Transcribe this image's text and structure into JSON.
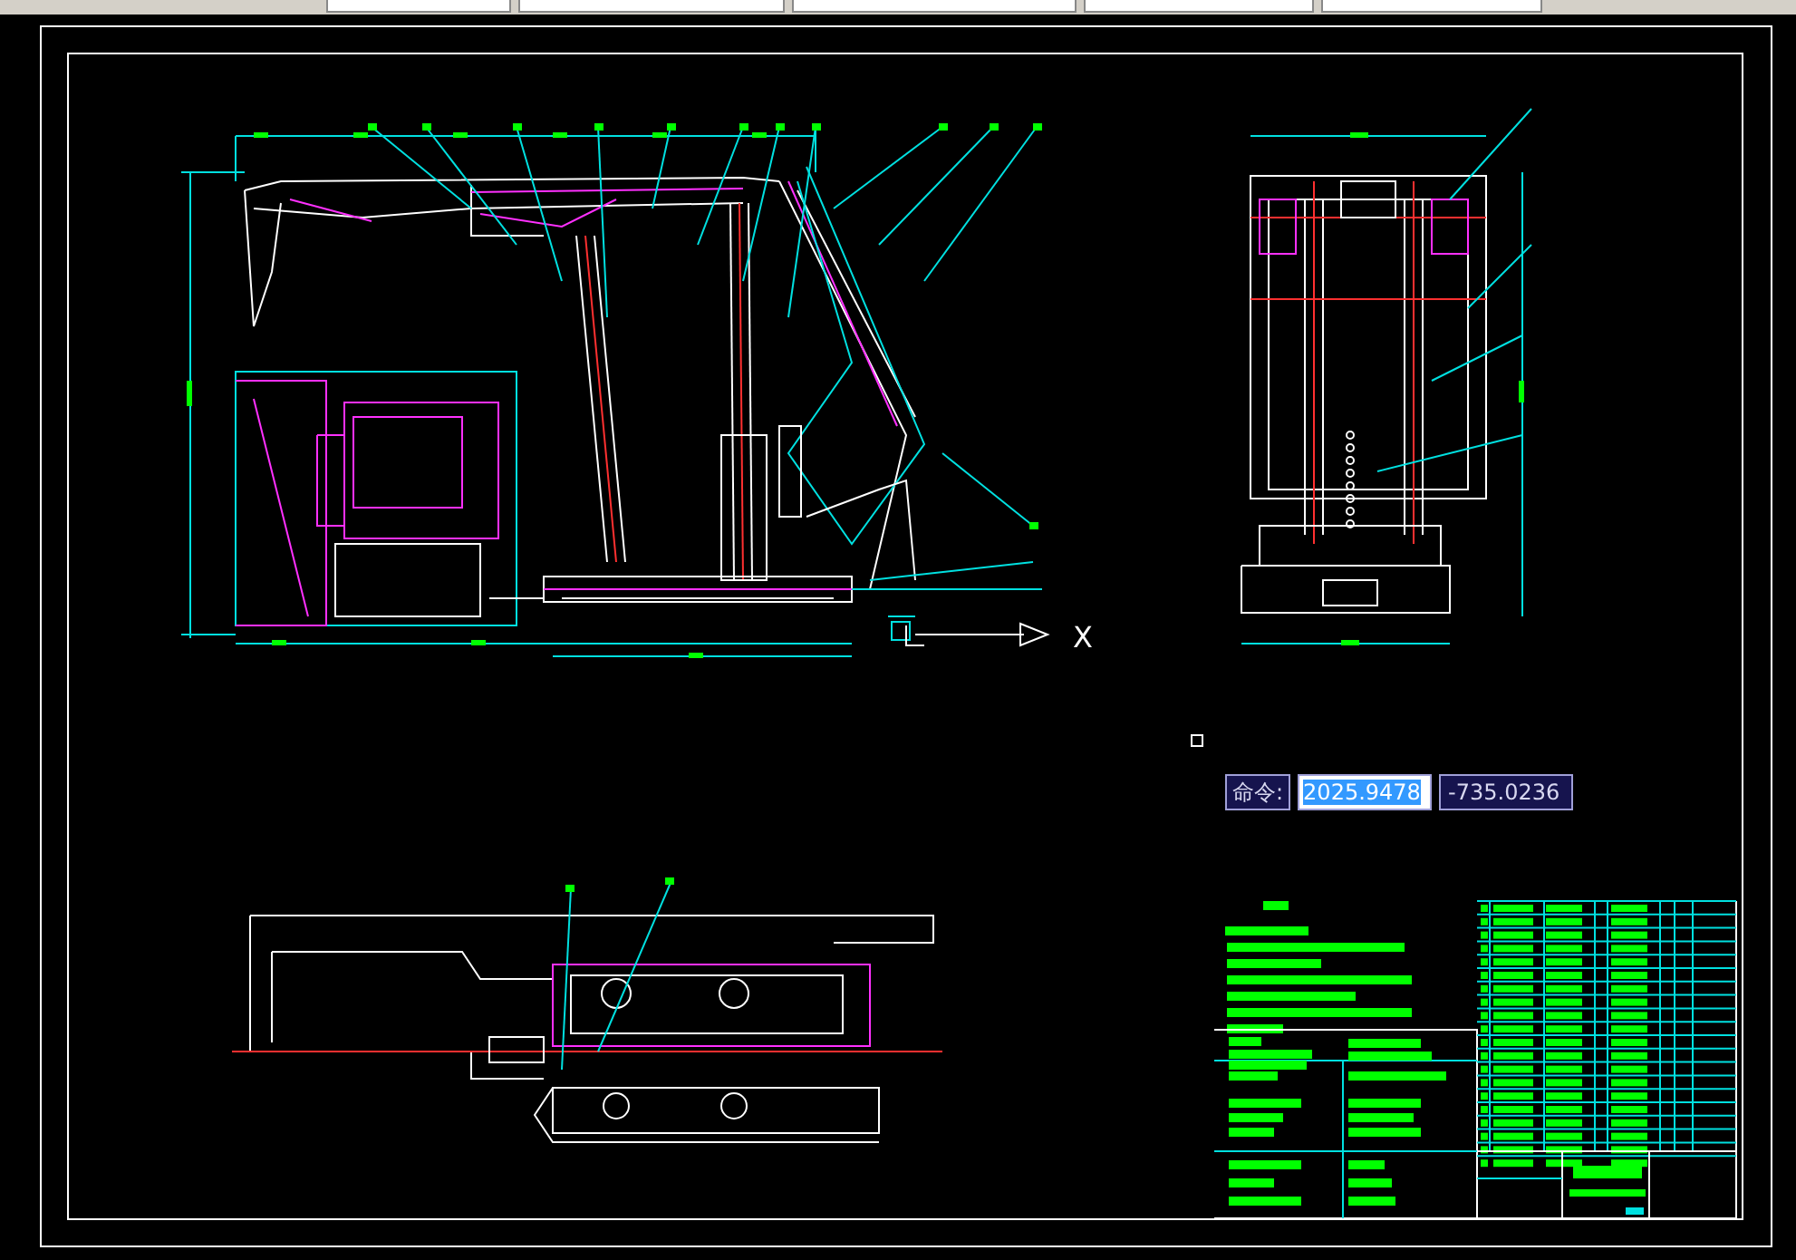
{
  "canvas": {
    "ucs_axis_label": "X",
    "dynamic_input": {
      "prompt": "命令:",
      "fields": [
        {
          "value": "2025.9478",
          "selected": true
        },
        {
          "value": "-735.0236",
          "selected": false
        }
      ]
    }
  }
}
